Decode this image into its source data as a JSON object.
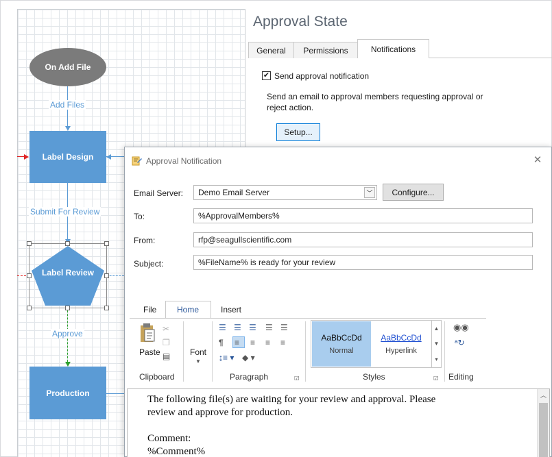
{
  "workflow": {
    "nodes": {
      "start": "On Add File",
      "design": "Label Design",
      "review": "Label Review",
      "production": "Production"
    },
    "edges": {
      "add_files": "Add Files",
      "submit_for_review": "Submit For Review",
      "approve": "Approve"
    }
  },
  "panel": {
    "title": "Approval State",
    "tabs": [
      "General",
      "Permissions",
      "Notifications"
    ],
    "active_tab": "Notifications",
    "send_notification_label": "Send approval notification",
    "send_notification_checked": true,
    "description_line1": "Send an email to approval members requesting approval or",
    "description_line2": "reject action.",
    "setup_button": "Setup..."
  },
  "dialog": {
    "title": "Approval Notification",
    "email_server_label": "Email Server:",
    "email_server_value": "Demo Email Server",
    "configure_button": "Configure...",
    "to_label": "To:",
    "to_value": "%ApprovalMembers%",
    "from_label": "From:",
    "from_value": "rfp@seagullscientific.com",
    "subject_label": "Subject:",
    "subject_value": "%FileName% is ready for your review",
    "ribbon": {
      "tabs": [
        "File",
        "Home",
        "Insert"
      ],
      "active_tab": "Home",
      "groups": {
        "clipboard": "Clipboard",
        "paragraph": "Paragraph",
        "styles": "Styles",
        "editing": "Editing"
      },
      "paste_label": "Paste",
      "font_label": "Font",
      "style_sample": "AaBbCcDd",
      "style_normal": "Normal",
      "style_hyperlink": "Hyperlink"
    },
    "editor": {
      "line1": "The following file(s) are waiting for your review and approval. Please",
      "line2": "review and approve for production.",
      "line3": "",
      "line4": "Comment:",
      "line5": "%Comment%"
    }
  },
  "colors": {
    "node_blue": "#5b9bd5",
    "node_gray": "#7b7b7b",
    "approve_green": "#2ca02c",
    "incoming_red": "#e02424"
  }
}
